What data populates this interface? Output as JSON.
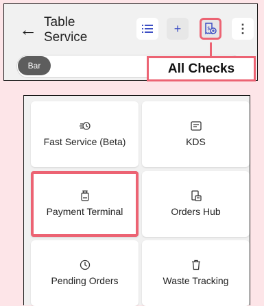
{
  "header": {
    "back_icon": "arrow-left-icon",
    "title": "Table\nService",
    "buttons": {
      "list_icon": "list-icon",
      "add_label": "+",
      "checks_icon": "receipt-add-icon",
      "more_label": "⋮"
    }
  },
  "filter": {
    "chip_label": "Bar"
  },
  "callout": {
    "label": "All Checks"
  },
  "tiles": [
    {
      "label": "Fast Service (Beta)",
      "icon": "fast-service-icon"
    },
    {
      "label": "KDS",
      "icon": "kds-icon"
    },
    {
      "label": "Payment Terminal",
      "icon": "payment-terminal-icon"
    },
    {
      "label": "Orders Hub",
      "icon": "orders-hub-icon"
    },
    {
      "label": "Pending Orders",
      "icon": "pending-clock-icon"
    },
    {
      "label": "Waste Tracking",
      "icon": "trash-icon"
    }
  ],
  "colors": {
    "highlight": "#ec6373",
    "accent": "#3d4fc4",
    "chip": "#5d5d5d",
    "background": "#fde5e8"
  }
}
